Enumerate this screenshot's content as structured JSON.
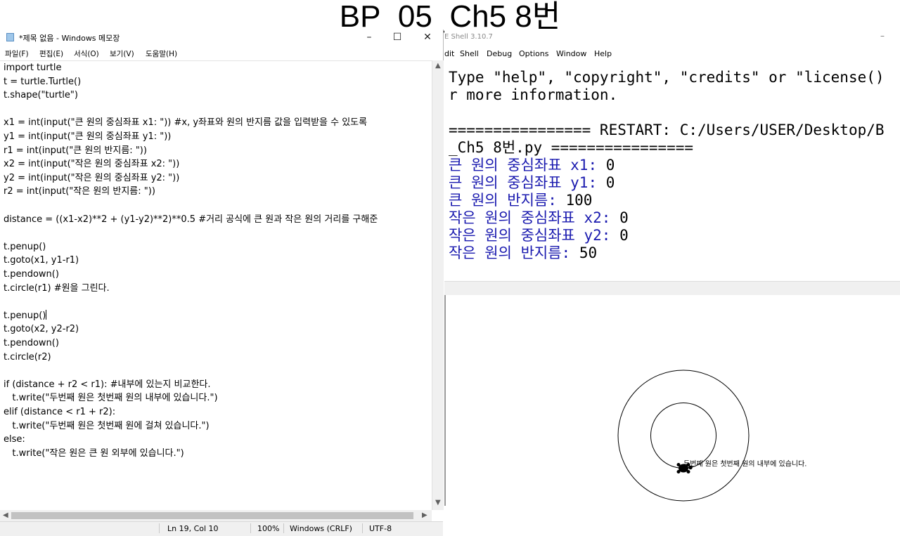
{
  "slide": {
    "title": "BP_05_Ch5 8번"
  },
  "notepad": {
    "window_title": "*제목 없음 - Windows 메모장",
    "window_buttons": {
      "minimize": "–",
      "maximize": "☐",
      "close": "✕"
    },
    "menu": [
      "파일(F)",
      "편집(E)",
      "서식(O)",
      "보기(V)",
      "도움말(H)"
    ],
    "code_lines": [
      "import turtle",
      "t = turtle.Turtle()",
      "t.shape(\"turtle\")",
      "",
      "x1 = int(input(\"큰 원의 중심좌표 x1: \")) #x, y좌표와 원의 반지름 값을 입력받을 수 있도록",
      "y1 = int(input(\"큰 원의 중심좌표 y1: \"))",
      "r1 = int(input(\"큰 원의 반지름: \"))",
      "x2 = int(input(\"작은 원의 중심좌표 x2: \"))",
      "y2 = int(input(\"작은 원의 중심좌표 y2: \"))",
      "r2 = int(input(\"작은 원의 반지름: \"))",
      "",
      "distance = ((x1-x2)**2 + (y1-y2)**2)**0.5 #거리 공식에 큰 원과 작은 원의 거리를 구해준",
      "",
      "t.penup()",
      "t.goto(x1, y1-r1)",
      "t.pendown()",
      "t.circle(r1) #원을 그린다.",
      "",
      "t.penup()",
      "t.goto(x2, y2-r2)",
      "t.pendown()",
      "t.circle(r2)",
      "",
      "if (distance + r2 < r1): #내부에 있는지 비교한다.",
      "   t.write(\"두번째 원은 첫번째 원의 내부에 있습니다.\")",
      "elif (distance < r1 + r2):",
      "   t.write(\"두번째 원은 첫번째 원에 걸쳐 있습니다.\")",
      "else:",
      "   t.write(\"작은 원은 큰 원 외부에 있습니다.\")"
    ],
    "status": {
      "position": "Ln 19, Col 10",
      "zoom": "100%",
      "line_ending": "Windows (CRLF)",
      "encoding": "UTF-8"
    }
  },
  "shell": {
    "window_title": "E Shell 3.10.7",
    "minimize": "–",
    "menu": [
      "dit",
      "Shell",
      "Debug",
      "Options",
      "Window",
      "Help"
    ],
    "output_lines": [
      "Type \"help\", \"copyright\", \"credits\" or \"license()",
      "r more information.",
      "",
      "================ RESTART: C:/Users/USER/Desktop/B",
      "_Ch5 8번.py ================"
    ],
    "inputs": [
      {
        "prompt": "큰 원의 중심좌표 x1: ",
        "value": "0"
      },
      {
        "prompt": "큰 원의 중심좌표 y1: ",
        "value": "0"
      },
      {
        "prompt": "큰 원의 반지름: ",
        "value": "100"
      },
      {
        "prompt": "작은 원의 중심좌표 x2: ",
        "value": "0"
      },
      {
        "prompt": "작은 원의 중심좌표 y2: ",
        "value": "0"
      },
      {
        "prompt": "작은 원의 반지름: ",
        "value": "50"
      }
    ]
  },
  "turtle": {
    "circles": [
      {
        "name": "big",
        "cx": 0,
        "cy": 0,
        "r": 100
      },
      {
        "name": "small",
        "cx": 0,
        "cy": 0,
        "r": 50
      }
    ],
    "message": "두번째 원은 첫번째 원의 내부에 있습니다.",
    "icon": "turtle-icon",
    "line_color": "#000000"
  }
}
